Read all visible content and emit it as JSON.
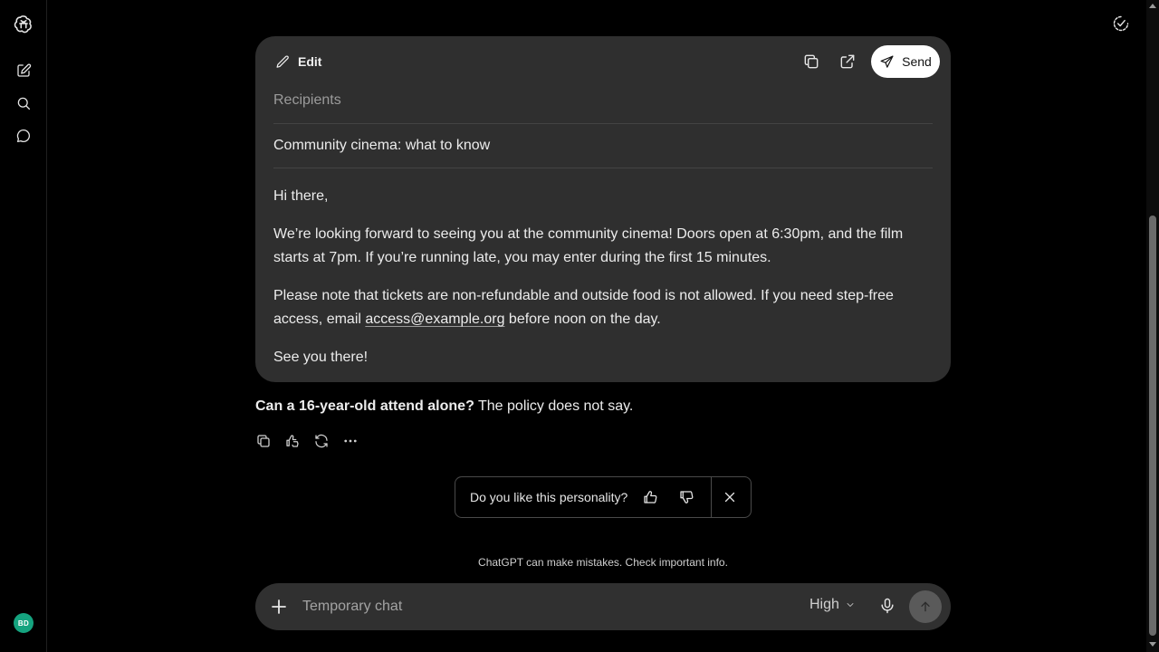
{
  "sidebar": {
    "icons": [
      "openai-logo-icon",
      "new-chat-icon",
      "search-icon",
      "chats-icon"
    ],
    "avatar_initials": "BD",
    "avatar_color": "#15a37f"
  },
  "header": {
    "right_icon": "temporary-chat-check-icon"
  },
  "email_card": {
    "edit_label": "Edit",
    "send_label": "Send",
    "recipients_placeholder": "Recipients",
    "subject": "Community cinema: what to know",
    "greeting": "Hi there,",
    "paragraph1": "We’re looking forward to seeing you at the community cinema! Doors open at 6:30pm, and the film starts at 7pm. If you’re running late, you may enter during the first 15 minutes.",
    "paragraph2_before": "Please note that tickets are non-refundable and outside food is not allowed. If you need step-free access, email ",
    "paragraph2_link": "access@example.org",
    "paragraph2_after": " before noon on the day.",
    "closing": "See you there!"
  },
  "response": {
    "bold": "Can a 16-year-old attend alone?",
    "rest": " The policy does not say."
  },
  "response_actions": [
    "copy-icon",
    "feedback-icon",
    "regenerate-icon",
    "more-icon"
  ],
  "personality_prompt": {
    "question": "Do you like this personality?"
  },
  "disclaimer": "ChatGPT can make mistakes. Check important info.",
  "composer": {
    "placeholder": "Temporary chat",
    "model_level": "High"
  },
  "colors": {
    "background": "#000000",
    "card": "#2f2f2f",
    "composer": "#303030",
    "send_button": "#ffffff"
  }
}
